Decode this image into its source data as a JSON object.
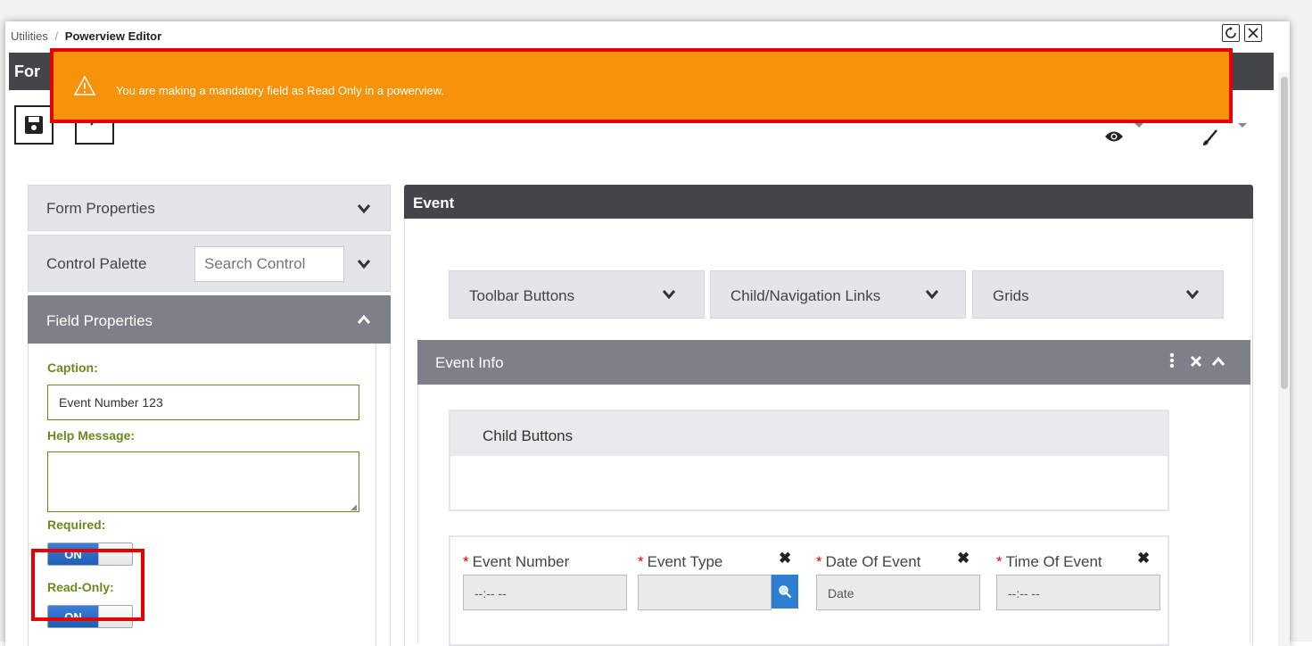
{
  "breadcrumb": {
    "parent": "Utilities",
    "separator": "/",
    "current": "Powerview Editor"
  },
  "header": {
    "form_title_partial": "For"
  },
  "toast": {
    "message": "You are making a mandatory field as Read Only in a powerview.",
    "color": "#f7930a",
    "border_color": "#e60000"
  },
  "left_panel": {
    "form_properties": "Form Properties",
    "control_palette": "Control Palette",
    "search_placeholder": "Search Control",
    "field_properties": "Field Properties",
    "caption_label": "Caption:",
    "caption_value": "Event Number 123",
    "help_label": "Help Message:",
    "help_value": "",
    "required_label": "Required:",
    "required_state": "ON",
    "readonly_label": "Read-Only:",
    "readonly_state": "ON"
  },
  "main": {
    "title": "Event",
    "dropdowns": [
      "Toolbar Buttons",
      "Child/Navigation Links",
      "Grids"
    ],
    "section_title": "Event Info",
    "child_buttons": "Child Buttons",
    "fields": [
      {
        "label": "Event Number",
        "required": true,
        "value": "--:-- --"
      },
      {
        "label": "Event Type",
        "required": true,
        "value": ""
      },
      {
        "label": "Date Of Event",
        "required": true,
        "value": "Date"
      },
      {
        "label": "Time Of Event",
        "required": true,
        "value": "--:-- --"
      }
    ],
    "required_marker": "*"
  },
  "colors": {
    "accent_green": "#6a8a1e",
    "dark_header": "#444549",
    "toggle_blue": "#1f5fb8",
    "section_gray": "#7d8088"
  }
}
